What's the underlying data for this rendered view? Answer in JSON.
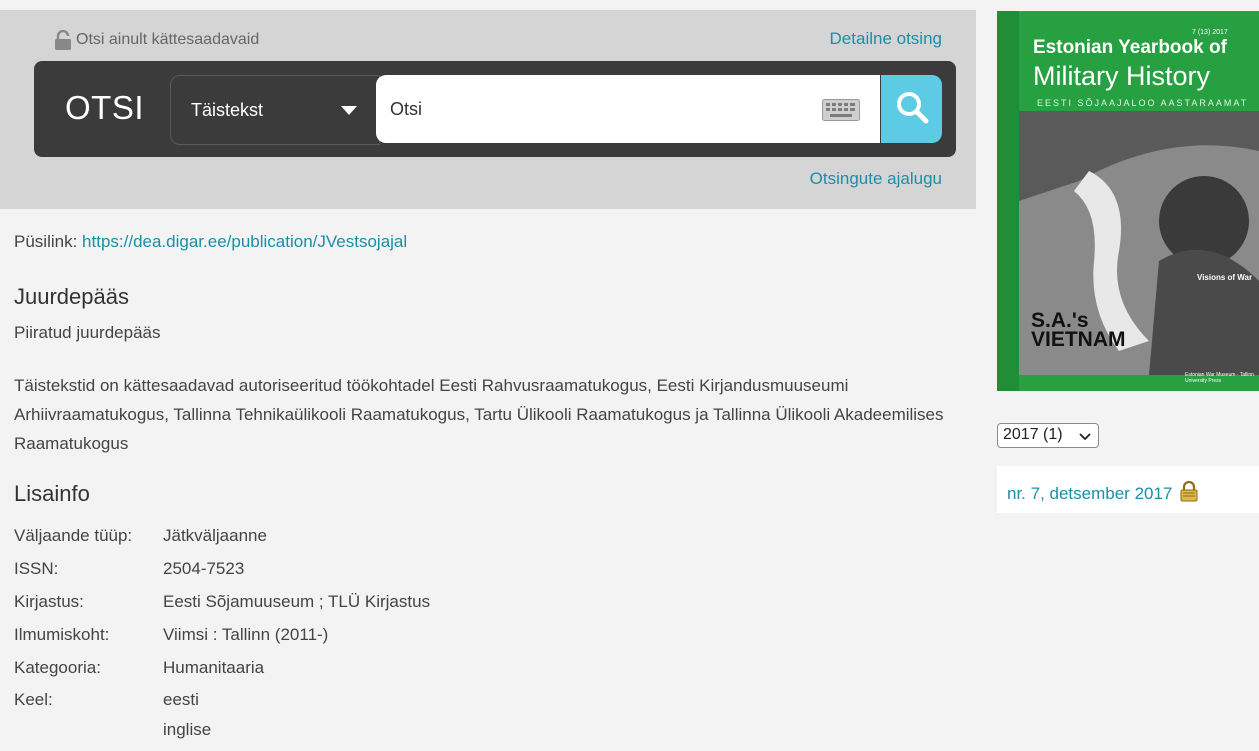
{
  "search": {
    "available_only_label": "Otsi ainult kättesaadavaid",
    "detailed_search_label": "Detailne otsing",
    "otsi_label": "OTSI",
    "type_selected": "Täistekst",
    "placeholder": "Otsi",
    "history_label": "Otsingute ajalugu"
  },
  "permalink": {
    "label": "Püsilink:",
    "url": "https://dea.digar.ee/publication/JVestsojajal"
  },
  "access": {
    "heading": "Juurdepääs",
    "value": "Piiratud juurdepääs",
    "description": "Täistekstid on kättesaadavad autoriseeritud töökohtadel Eesti Rahvusraamatukogus, Eesti Kirjandusmuuseumi Arhiivraamatukogus, Tallinna Tehnikaülikooli Raamatukogus, Tartu Ülikooli Raamatukogus ja Tallinna Ülikooli Akadeemilises Raamatukogus"
  },
  "info": {
    "heading": "Lisainfo",
    "rows": [
      {
        "key": "Väljaande tüüp:",
        "value": "Jätkväljaanne"
      },
      {
        "key": "ISSN:",
        "value": "2504-7523"
      },
      {
        "key": "Kirjastus:",
        "value": "Eesti Sõjamuuseum ; TLÜ Kirjastus"
      },
      {
        "key": "Ilmumiskoht:",
        "value": "Viimsi : Tallinn (2011-)"
      },
      {
        "key": "Kategooria:",
        "value": "Humanitaaria"
      }
    ],
    "language_key": "Keel:",
    "languages": [
      "eesti",
      "inglise"
    ]
  },
  "cover": {
    "issue_no": "7 (13) 2017",
    "title_line1": "Estonian Yearbook of",
    "title_line2": "Military History",
    "subtitle": "EESTI SÕJAAJALOO AASTARAAMAT",
    "feature_line1": "S.A.'s",
    "feature_line2": "VIETNAM",
    "visions": "Visions of War",
    "publisher": "Estonian War Museum · Tallinn University Press"
  },
  "year_select": "2017 (1)",
  "issue_link": "nr. 7, detsember 2017",
  "colors": {
    "link": "#1a8fa8",
    "search_button": "#5ccbe3",
    "search_bar": "#3b3b3b",
    "cover_green": "#26a040"
  }
}
